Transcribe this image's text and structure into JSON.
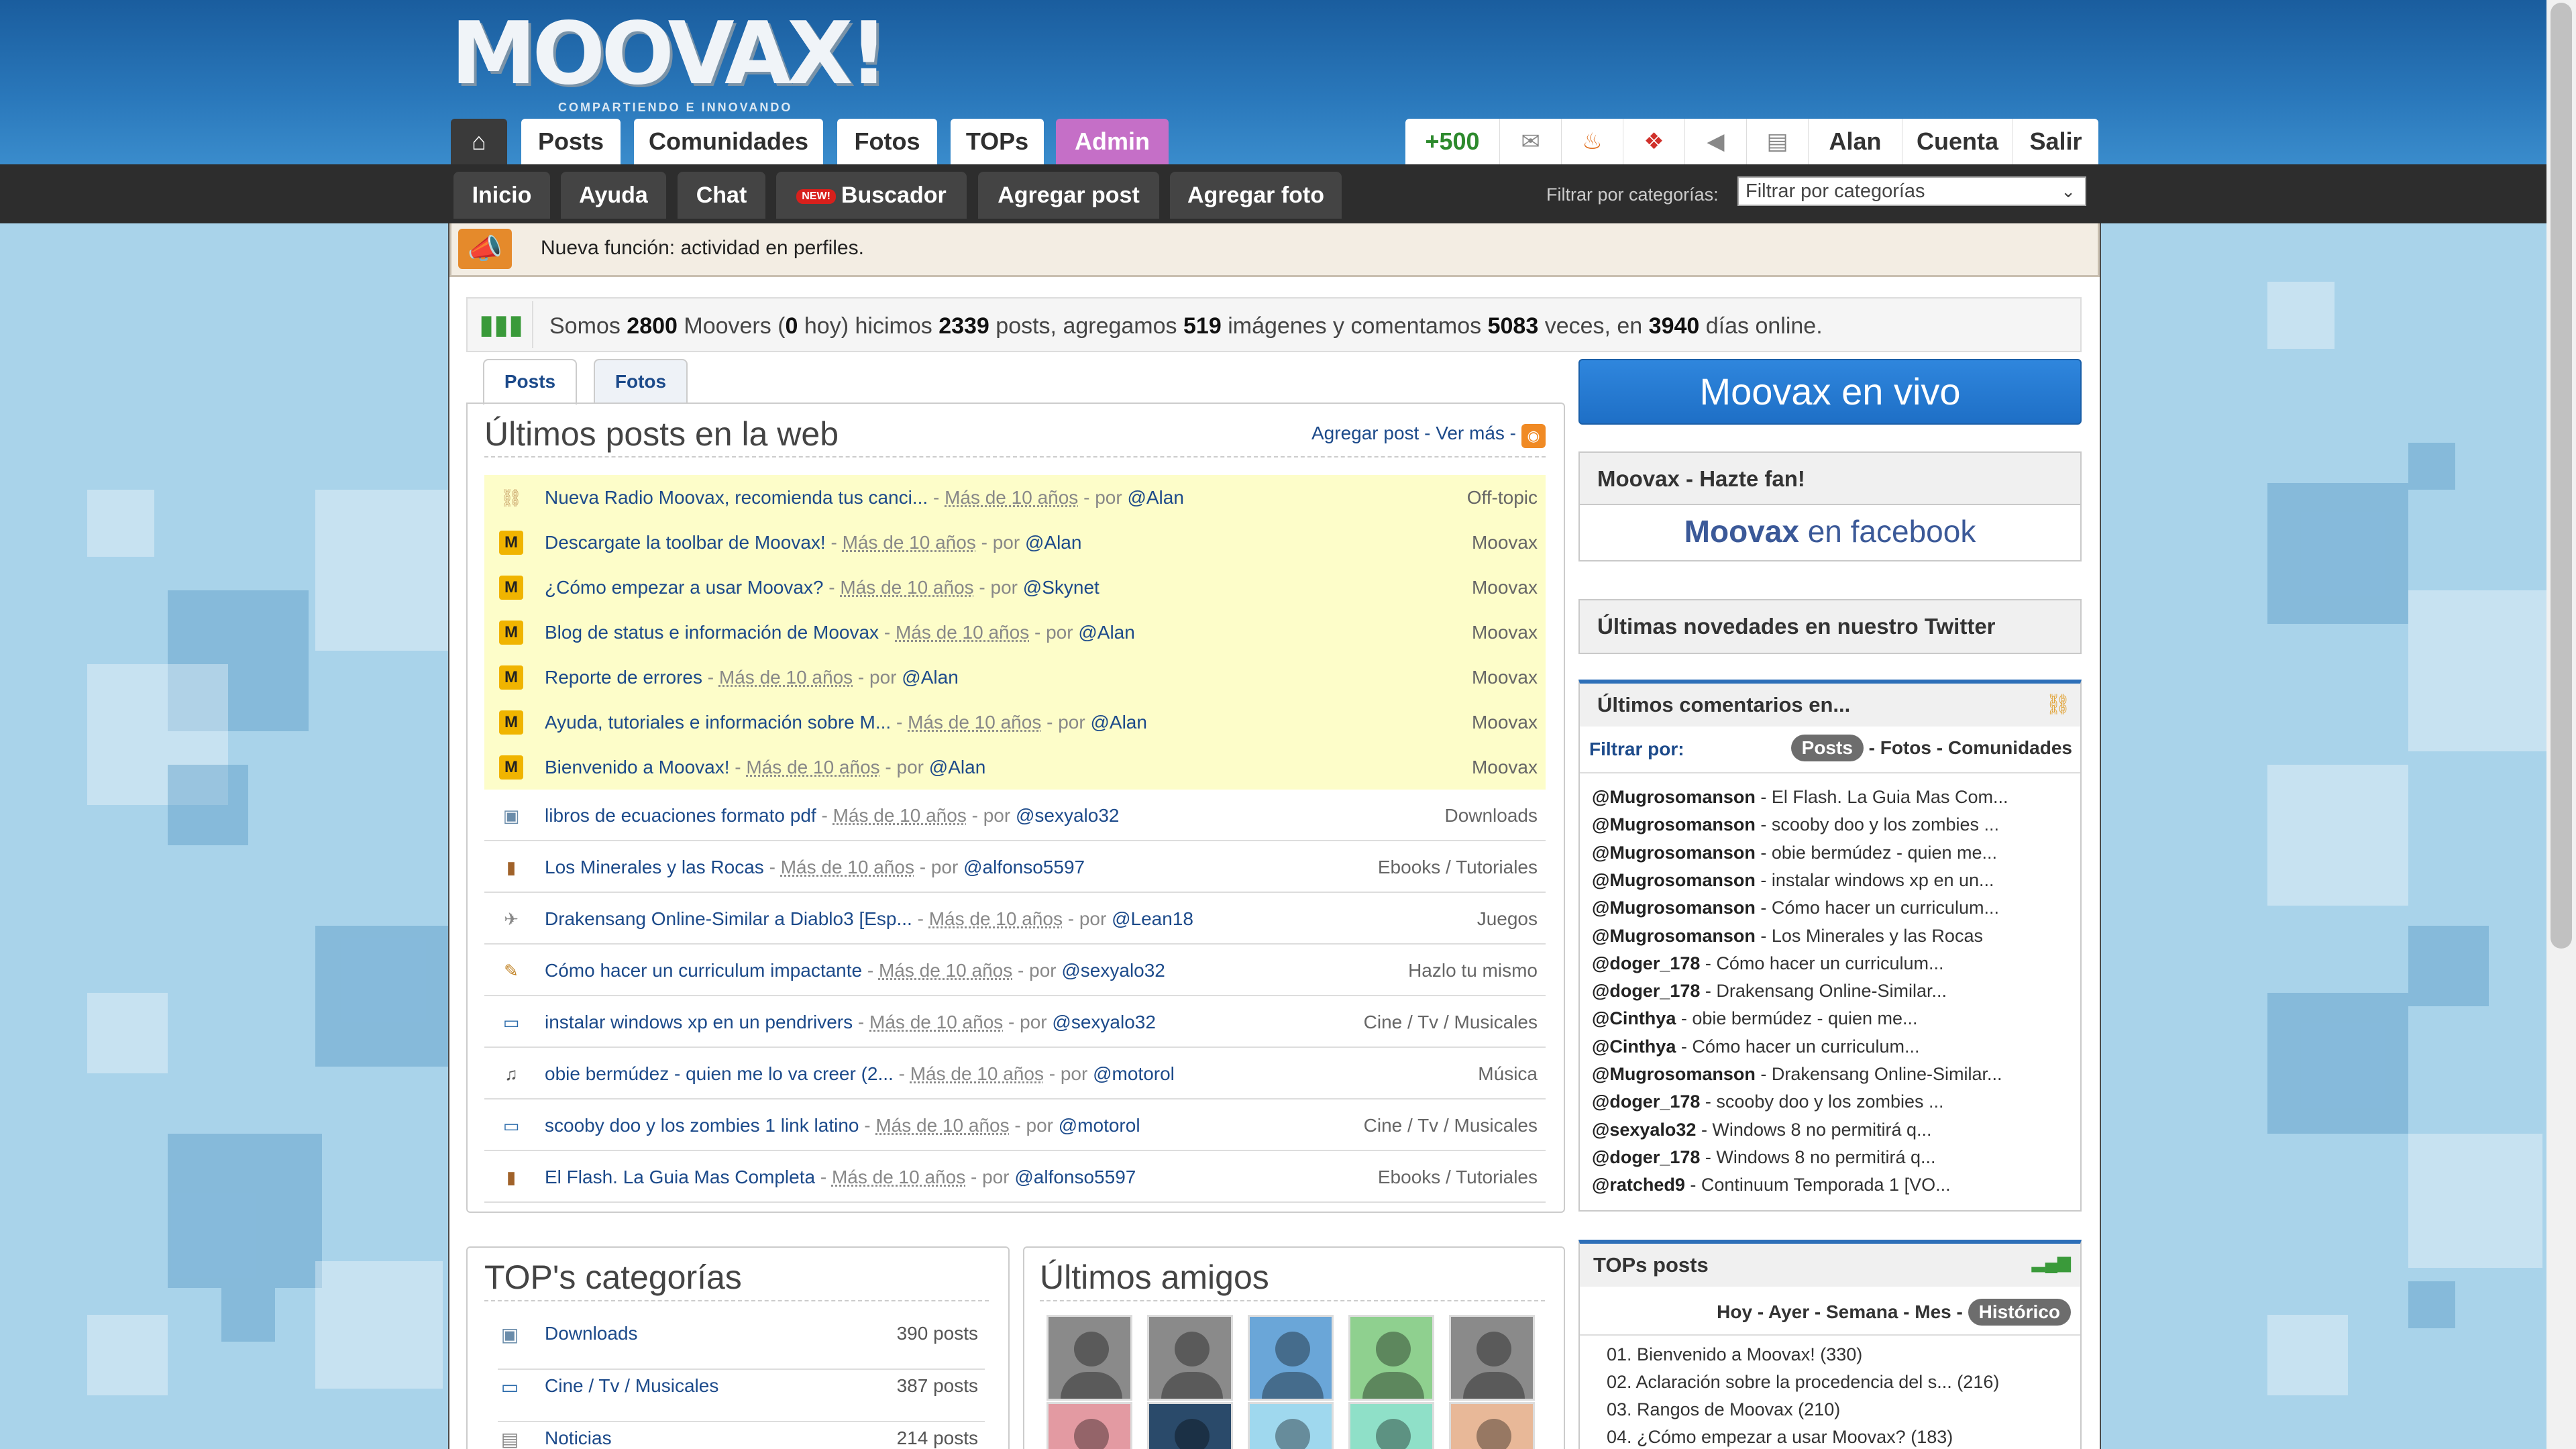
{
  "brand": {
    "logo": "MOOVAX!",
    "tagline": "COMPARTIENDO E INNOVANDO"
  },
  "nav": {
    "home_icon": "home-icon",
    "tabs": [
      "Posts",
      "Comunidades",
      "Fotos",
      "TOPs",
      "Admin"
    ]
  },
  "user_bar": {
    "points": "+500",
    "icons": [
      "mail-icon",
      "fire-icon",
      "gift-icon",
      "speaker-icon",
      "clipboard-icon"
    ],
    "user": "Alan",
    "account": "Cuenta",
    "logout": "Salir"
  },
  "subnav": {
    "items": [
      "Inicio",
      "Ayuda",
      "Chat",
      "Buscador",
      "Agregar post",
      "Agregar foto"
    ],
    "new_badge": "NEW!",
    "filter_label": "Filtrar por categorías:",
    "filter_value": "Filtrar por categorías"
  },
  "announcement": {
    "text": "Nueva función: actividad en perfiles."
  },
  "stats": {
    "p1": "Somos",
    "moovers": "2800",
    "p2": "Moovers (",
    "today": "0",
    "p3": "hoy) hicimos",
    "posts": "2339",
    "p4": "posts, agregamos",
    "images": "519",
    "p5": "imágenes y comentamos",
    "comments": "5083",
    "p6": "veces, en",
    "days": "3940",
    "p7": "días online."
  },
  "content_tabs": [
    "Posts",
    "Fotos"
  ],
  "posts": {
    "title": "Últimos posts en la web",
    "links": "Agregar post - Ver más -",
    "sticky": [
      {
        "icon": "chain-icon",
        "title": "Nueva Radio Moovax, recomienda tus canci...",
        "date": "Más de 10 años",
        "user": "@Alan",
        "cat": "Off-topic"
      },
      {
        "icon": "M",
        "title": "Descargate la toolbar de Moovax!",
        "date": "Más de 10 años",
        "user": "@Alan",
        "cat": "Moovax"
      },
      {
        "icon": "M",
        "title": "¿Cómo empezar a usar Moovax?",
        "date": "Más de 10 años",
        "user": "@Skynet",
        "cat": "Moovax"
      },
      {
        "icon": "M",
        "title": "Blog de status e información de Moovax",
        "date": "Más de 10 años",
        "user": "@Alan",
        "cat": "Moovax"
      },
      {
        "icon": "M",
        "title": "Reporte de errores",
        "date": "Más de 10 años",
        "user": "@Alan",
        "cat": "Moovax"
      },
      {
        "icon": "M",
        "title": "Ayuda, tutoriales e información sobre M...",
        "date": "Más de 10 años",
        "user": "@Alan",
        "cat": "Moovax"
      },
      {
        "icon": "M",
        "title": "Bienvenido a Moovax!",
        "date": "Más de 10 años",
        "user": "@Alan",
        "cat": "Moovax"
      }
    ],
    "recent": [
      {
        "icon": "floppy-icon",
        "title": "libros de ecuaciones formato pdf",
        "date": "Más de 10 años",
        "user": "@sexyalo32",
        "cat": "Downloads"
      },
      {
        "icon": "book-icon",
        "title": "Los Minerales y las Rocas",
        "date": "Más de 10 años",
        "user": "@alfonso5597",
        "cat": "Ebooks / Tutoriales"
      },
      {
        "icon": "gamepad-icon",
        "title": "Drakensang Online-Similar a Diablo3 [Esp...",
        "date": "Más de 10 años",
        "user": "@Lean18",
        "cat": "Juegos"
      },
      {
        "icon": "tools-icon",
        "title": "Cómo hacer un curriculum impactante",
        "date": "Más de 10 años",
        "user": "@sexyalo32",
        "cat": "Hazlo tu mismo"
      },
      {
        "icon": "monitor-icon",
        "title": "instalar windows xp en un pendrivers",
        "date": "Más de 10 años",
        "user": "@sexyalo32",
        "cat": "Cine / Tv / Musicales"
      },
      {
        "icon": "music-note-icon",
        "title": "obie bermúdez - quien me lo va creer (2...",
        "date": "Más de 10 años",
        "user": "@motorol",
        "cat": "Música"
      },
      {
        "icon": "monitor-icon",
        "title": "scooby doo y los zombies 1 link latino",
        "date": "Más de 10 años",
        "user": "@motorol",
        "cat": "Cine / Tv / Musicales"
      },
      {
        "icon": "book-icon",
        "title": "El Flash. La Guia Mas Completa",
        "date": "Más de 10 años",
        "user": "@alfonso5597",
        "cat": "Ebooks / Tutoriales"
      }
    ],
    "sep": " - ",
    "by": " - por "
  },
  "top_categories": {
    "title": "TOP's categorías",
    "items": [
      {
        "icon": "floppy-icon",
        "name": "Downloads",
        "count": "390 posts"
      },
      {
        "icon": "monitor-icon",
        "name": "Cine / Tv / Musicales",
        "count": "387 posts"
      },
      {
        "icon": "newspaper-icon",
        "name": "Noticias",
        "count": "214 posts"
      }
    ]
  },
  "friends": {
    "title": "Últimos amigos",
    "avatar_colors": [
      "#8a8a8a",
      "#8a8a8a",
      "#6aa6d8",
      "#8fd08f",
      "#8a8a8a",
      "#e39aa2",
      "#2a4a6a",
      "#9fd8ee",
      "#8fe0c8",
      "#e8b898"
    ]
  },
  "sidebar": {
    "live": "Moovax en vivo",
    "fan_title": "Moovax - Hazte fan!",
    "fb_brand": "Moovax",
    "fb_suffix": " en facebook",
    "twitter_title": "Últimas novedades en nuestro Twitter",
    "comments_title": "Últimos comentarios en...",
    "filter_label": "Filtrar por:",
    "filter_active": "Posts",
    "filter_rest": " - Fotos - Comunidades",
    "comments": [
      {
        "user": "@Mugrosomanson",
        "text": " - El Flash. La Guia Mas Com..."
      },
      {
        "user": "@Mugrosomanson",
        "text": " - scooby doo y los zombies ..."
      },
      {
        "user": "@Mugrosomanson",
        "text": " - obie bermúdez - quien me..."
      },
      {
        "user": "@Mugrosomanson",
        "text": " - instalar windows xp en un..."
      },
      {
        "user": "@Mugrosomanson",
        "text": " - Cómo hacer un curriculum..."
      },
      {
        "user": "@Mugrosomanson",
        "text": " - Los Minerales y las Rocas"
      },
      {
        "user": "@doger_178",
        "text": " - Cómo hacer un curriculum..."
      },
      {
        "user": "@doger_178",
        "text": " - Drakensang Online-Similar..."
      },
      {
        "user": "@Cinthya",
        "text": " - obie bermúdez - quien me..."
      },
      {
        "user": "@Cinthya",
        "text": " - Cómo hacer un curriculum..."
      },
      {
        "user": "@Mugrosomanson",
        "text": " - Drakensang Online-Similar..."
      },
      {
        "user": "@doger_178",
        "text": " - scooby doo y los zombies ..."
      },
      {
        "user": "@sexyalo32",
        "text": " - Windows 8 no permitirá q..."
      },
      {
        "user": "@doger_178",
        "text": " - Windows 8 no permitirá q..."
      },
      {
        "user": "@ratched9",
        "text": " - Continuum Temporada 1 [VO..."
      }
    ],
    "tops_title": "TOPs posts",
    "tops_filters": "Hoy - Ayer - Semana - Mes -",
    "tops_active": "Histórico",
    "tops": [
      "01. Bienvenido a Moovax! (330)",
      "02. Aclaración sobre la procedencia del s... (216)",
      "03. Rangos de Moovax (210)",
      "04. ¿Cómo empezar a usar Moovax? (183)"
    ]
  },
  "colors": {
    "header": "#1a5d9e",
    "admin": "#c56fc7",
    "sticky_bg": "#fdfdc9",
    "link": "#1c4a8a",
    "live": "#2f86dd"
  }
}
